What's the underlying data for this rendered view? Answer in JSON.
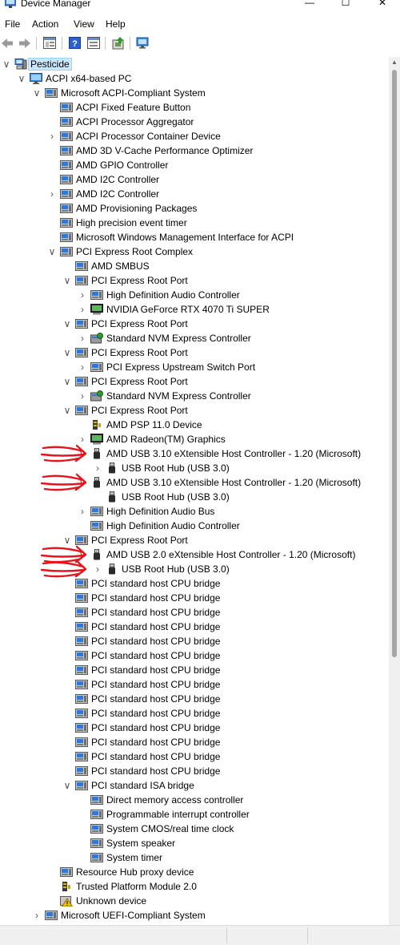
{
  "window": {
    "title": "Device Manager"
  },
  "menu": [
    "File",
    "Action",
    "View",
    "Help"
  ],
  "toolbar": [
    "back-icon",
    "forward-icon",
    "properties-sheet-icon",
    "help-icon",
    "show-hidden-icon",
    "update-driver-icon",
    "monitor-scan-icon"
  ],
  "tree": [
    {
      "label": "Pesticide",
      "level": 0,
      "exp": "open",
      "icon": "computer",
      "selected": true
    },
    {
      "label": "ACPI x64-based PC",
      "level": 1,
      "exp": "open",
      "icon": "monitor"
    },
    {
      "label": "Microsoft ACPI-Compliant System",
      "level": 2,
      "exp": "open",
      "icon": "device"
    },
    {
      "label": "ACPI Fixed Feature Button",
      "level": 3,
      "exp": "none",
      "icon": "device"
    },
    {
      "label": "ACPI Processor Aggregator",
      "level": 3,
      "exp": "none",
      "icon": "device"
    },
    {
      "label": "ACPI Processor Container Device",
      "level": 3,
      "exp": "closed",
      "icon": "device"
    },
    {
      "label": "AMD 3D V-Cache Performance Optimizer",
      "level": 3,
      "exp": "none",
      "icon": "device"
    },
    {
      "label": "AMD GPIO Controller",
      "level": 3,
      "exp": "none",
      "icon": "device"
    },
    {
      "label": "AMD I2C Controller",
      "level": 3,
      "exp": "none",
      "icon": "device"
    },
    {
      "label": "AMD I2C Controller",
      "level": 3,
      "exp": "closed",
      "icon": "device"
    },
    {
      "label": "AMD Provisioning Packages",
      "level": 3,
      "exp": "none",
      "icon": "device"
    },
    {
      "label": "High precision event timer",
      "level": 3,
      "exp": "none",
      "icon": "device"
    },
    {
      "label": "Microsoft Windows Management Interface for ACPI",
      "level": 3,
      "exp": "none",
      "icon": "device"
    },
    {
      "label": "PCI Express Root Complex",
      "level": 3,
      "exp": "open",
      "icon": "device"
    },
    {
      "label": "AMD SMBUS",
      "level": 4,
      "exp": "none",
      "icon": "device"
    },
    {
      "label": "PCI Express Root Port",
      "level": 4,
      "exp": "open",
      "icon": "device"
    },
    {
      "label": "High Definition Audio Controller",
      "level": 5,
      "exp": "closed",
      "icon": "device"
    },
    {
      "label": "NVIDIA GeForce RTX 4070 Ti SUPER",
      "level": 5,
      "exp": "closed",
      "icon": "display"
    },
    {
      "label": "PCI Express Root Port",
      "level": 4,
      "exp": "open",
      "icon": "device"
    },
    {
      "label": "Standard NVM Express Controller",
      "level": 5,
      "exp": "closed",
      "icon": "storage"
    },
    {
      "label": "PCI Express Root Port",
      "level": 4,
      "exp": "open",
      "icon": "device"
    },
    {
      "label": "PCI Express Upstream Switch Port",
      "level": 5,
      "exp": "closed",
      "icon": "device"
    },
    {
      "label": "PCI Express Root Port",
      "level": 4,
      "exp": "open",
      "icon": "device"
    },
    {
      "label": "Standard NVM Express Controller",
      "level": 5,
      "exp": "closed",
      "icon": "storage"
    },
    {
      "label": "PCI Express Root Port",
      "level": 4,
      "exp": "open",
      "icon": "device"
    },
    {
      "label": "AMD PSP 11.0 Device",
      "level": 5,
      "exp": "none",
      "icon": "security"
    },
    {
      "label": "AMD Radeon(TM) Graphics",
      "level": 5,
      "exp": "closed",
      "icon": "display"
    },
    {
      "label": "AMD USB 3.10 eXtensible Host Controller - 1.20 (Microsoft)",
      "level": 5,
      "exp": "open",
      "icon": "usb"
    },
    {
      "label": "USB Root Hub (USB 3.0)",
      "level": 6,
      "exp": "closed",
      "icon": "usb"
    },
    {
      "label": "AMD USB 3.10 eXtensible Host Controller - 1.20 (Microsoft)",
      "level": 5,
      "exp": "open",
      "icon": "usb"
    },
    {
      "label": "USB Root Hub (USB 3.0)",
      "level": 6,
      "exp": "none",
      "icon": "usb"
    },
    {
      "label": "High Definition Audio Bus",
      "level": 5,
      "exp": "closed",
      "icon": "device"
    },
    {
      "label": "High Definition Audio Controller",
      "level": 5,
      "exp": "none",
      "icon": "device"
    },
    {
      "label": "PCI Express Root Port",
      "level": 4,
      "exp": "open",
      "icon": "device"
    },
    {
      "label": "AMD USB 2.0 eXtensible Host Controller - 1.20 (Microsoft)",
      "level": 5,
      "exp": "open",
      "icon": "usb"
    },
    {
      "label": "USB Root Hub (USB 3.0)",
      "level": 6,
      "exp": "closed",
      "icon": "usb"
    },
    {
      "label": "PCI standard host CPU bridge",
      "level": 4,
      "exp": "none",
      "icon": "device"
    },
    {
      "label": "PCI standard host CPU bridge",
      "level": 4,
      "exp": "none",
      "icon": "device"
    },
    {
      "label": "PCI standard host CPU bridge",
      "level": 4,
      "exp": "none",
      "icon": "device"
    },
    {
      "label": "PCI standard host CPU bridge",
      "level": 4,
      "exp": "none",
      "icon": "device"
    },
    {
      "label": "PCI standard host CPU bridge",
      "level": 4,
      "exp": "none",
      "icon": "device"
    },
    {
      "label": "PCI standard host CPU bridge",
      "level": 4,
      "exp": "none",
      "icon": "device"
    },
    {
      "label": "PCI standard host CPU bridge",
      "level": 4,
      "exp": "none",
      "icon": "device"
    },
    {
      "label": "PCI standard host CPU bridge",
      "level": 4,
      "exp": "none",
      "icon": "device"
    },
    {
      "label": "PCI standard host CPU bridge",
      "level": 4,
      "exp": "none",
      "icon": "device"
    },
    {
      "label": "PCI standard host CPU bridge",
      "level": 4,
      "exp": "none",
      "icon": "device"
    },
    {
      "label": "PCI standard host CPU bridge",
      "level": 4,
      "exp": "none",
      "icon": "device"
    },
    {
      "label": "PCI standard host CPU bridge",
      "level": 4,
      "exp": "none",
      "icon": "device"
    },
    {
      "label": "PCI standard host CPU bridge",
      "level": 4,
      "exp": "none",
      "icon": "device"
    },
    {
      "label": "PCI standard host CPU bridge",
      "level": 4,
      "exp": "none",
      "icon": "device"
    },
    {
      "label": "PCI standard ISA bridge",
      "level": 4,
      "exp": "open",
      "icon": "device"
    },
    {
      "label": "Direct memory access controller",
      "level": 5,
      "exp": "none",
      "icon": "device"
    },
    {
      "label": "Programmable interrupt controller",
      "level": 5,
      "exp": "none",
      "icon": "device"
    },
    {
      "label": "System CMOS/real time clock",
      "level": 5,
      "exp": "none",
      "icon": "device"
    },
    {
      "label": "System speaker",
      "level": 5,
      "exp": "none",
      "icon": "device"
    },
    {
      "label": "System timer",
      "level": 5,
      "exp": "none",
      "icon": "device"
    },
    {
      "label": "Resource Hub proxy device",
      "level": 3,
      "exp": "none",
      "icon": "device"
    },
    {
      "label": "Trusted Platform Module 2.0",
      "level": 3,
      "exp": "none",
      "icon": "security"
    },
    {
      "label": "Unknown device",
      "level": 3,
      "exp": "none",
      "icon": "warning"
    },
    {
      "label": "Microsoft UEFI-Compliant System",
      "level": 2,
      "exp": "closed",
      "icon": "device"
    }
  ],
  "annotations": {
    "arrow_color": "#e8141b",
    "marked_rows": [
      27,
      29,
      34,
      35
    ]
  }
}
